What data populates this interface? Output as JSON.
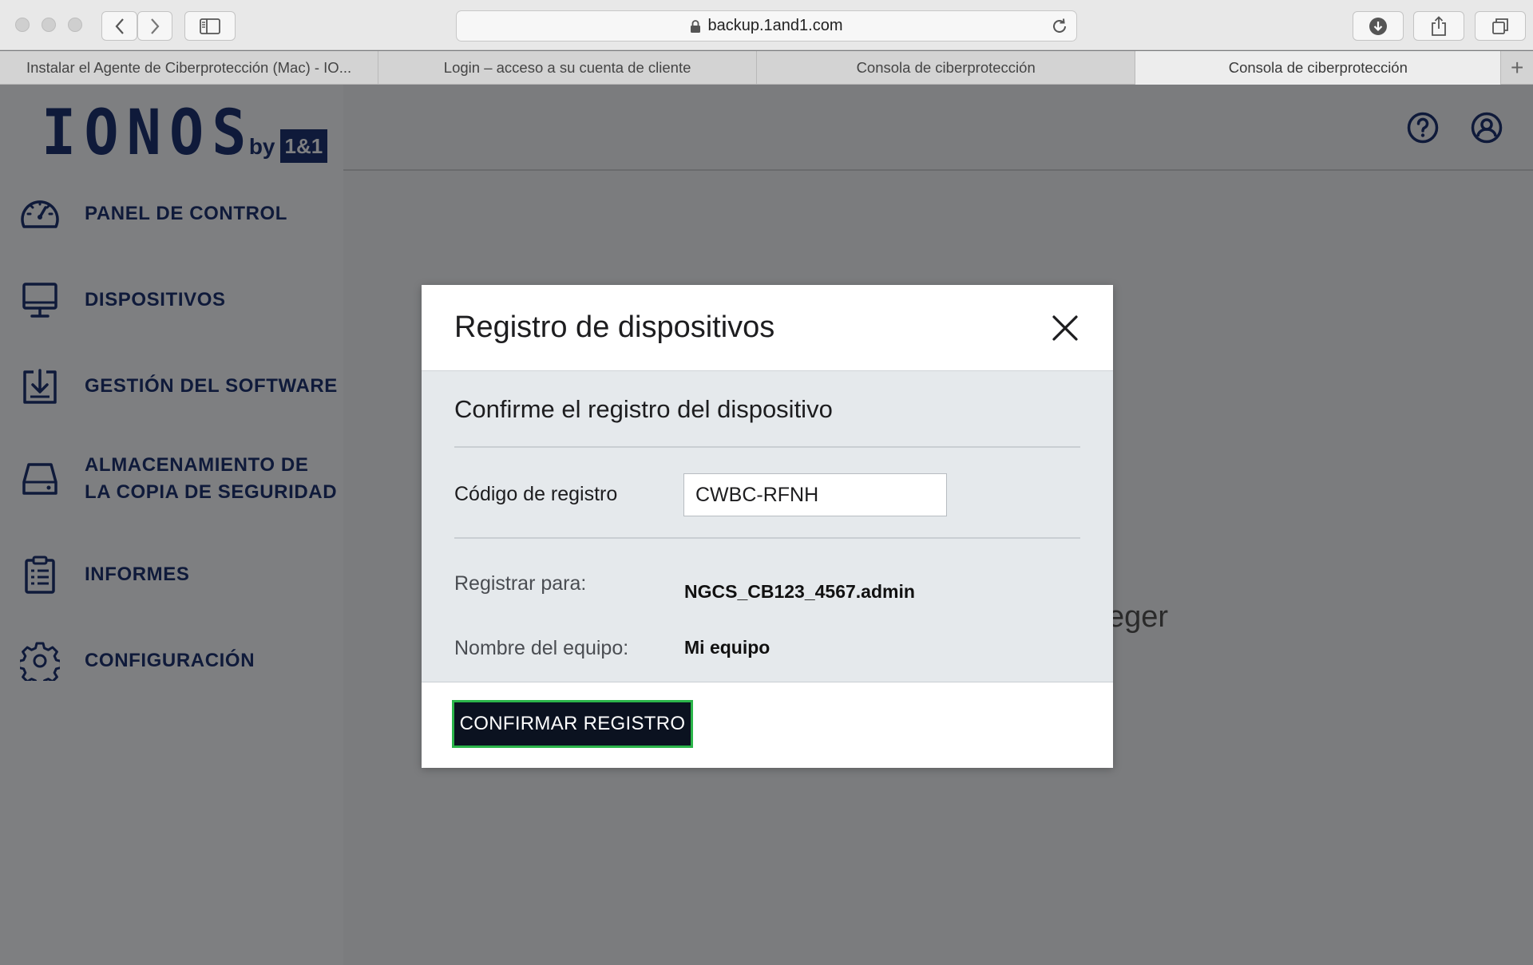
{
  "browser": {
    "url": "backup.1and1.com",
    "tabs": [
      {
        "label": "Instalar el Agente de Ciberprotección (Mac) - IO..."
      },
      {
        "label": "Login – acceso a su cuenta de cliente"
      },
      {
        "label": "Consola de ciberprotección"
      },
      {
        "label": "Consola de ciberprotección"
      }
    ],
    "new_tab_glyph": "+"
  },
  "logo": {
    "word": "IONOS",
    "by": "by",
    "box": "1&1"
  },
  "header": {
    "icons": [
      "help-icon",
      "account-icon"
    ]
  },
  "sidebar": {
    "items": [
      {
        "label": "PANEL DE CONTROL",
        "icon": "dashboard-icon"
      },
      {
        "label": "DISPOSITIVOS",
        "icon": "monitor-icon"
      },
      {
        "label": "GESTIÓN DEL SOFTWARE",
        "icon": "software-download-icon"
      },
      {
        "label1": "ALMACENAMIENTO DE",
        "label2": "LA COPIA DE SEGURIDAD",
        "icon": "storage-drive-icon"
      },
      {
        "label": "INFORMES",
        "icon": "clipboard-report-icon"
      },
      {
        "label": "CONFIGURACIÓN",
        "icon": "gear-icon"
      }
    ]
  },
  "background": {
    "partial_text": "eger"
  },
  "modal": {
    "title": "Registro de dispositivos",
    "subtitle": "Confirme el registro del dispositivo",
    "code_label": "Código de registro",
    "code_value": "CWBC-RFNH",
    "register_for_label": "Registrar para:",
    "register_for_value": "NGCS_CB123_4567.admin",
    "machine_label": "Nombre del equipo:",
    "machine_value": "Mi equipo",
    "confirm_button": "CONFIRMAR REGISTRO"
  },
  "colors": {
    "brand_navy": "#0f1a3a",
    "button_bg": "#0b1220",
    "button_focus": "#2bb54a"
  }
}
